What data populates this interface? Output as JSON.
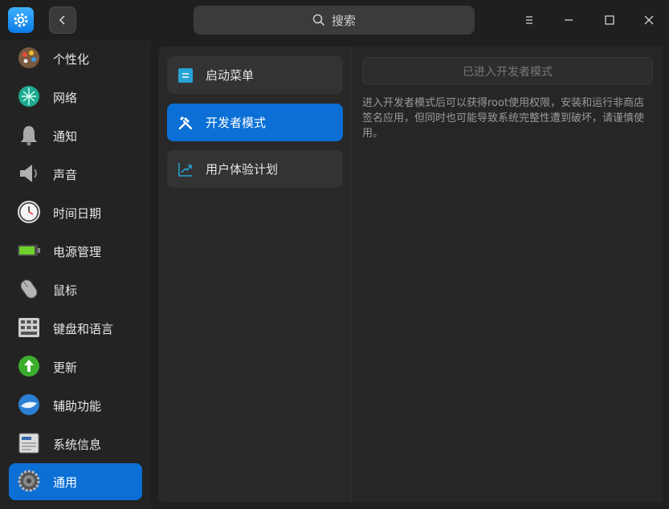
{
  "search": {
    "label": "搜索"
  },
  "sidebar": {
    "items": [
      {
        "label": "个性化",
        "icon": "personalization-icon"
      },
      {
        "label": "网络",
        "icon": "network-icon"
      },
      {
        "label": "通知",
        "icon": "bell-icon"
      },
      {
        "label": "声音",
        "icon": "speaker-icon"
      },
      {
        "label": "时间日期",
        "icon": "clock-icon"
      },
      {
        "label": "电源管理",
        "icon": "battery-icon"
      },
      {
        "label": "鼠标",
        "icon": "mouse-icon"
      },
      {
        "label": "键盘和语言",
        "icon": "keyboard-icon"
      },
      {
        "label": "更新",
        "icon": "update-icon"
      },
      {
        "label": "辅助功能",
        "icon": "accessibility-icon"
      },
      {
        "label": "系统信息",
        "icon": "system-info-icon"
      },
      {
        "label": "通用",
        "icon": "general-gear-icon"
      }
    ],
    "active_index": 11
  },
  "middle": {
    "items": [
      {
        "label": "启动菜单",
        "icon": "boot-menu-icon"
      },
      {
        "label": "开发者模式",
        "icon": "tools-icon"
      },
      {
        "label": "用户体验计划",
        "icon": "chart-trend-icon"
      }
    ],
    "active_index": 1
  },
  "right": {
    "dev_button_label": "已进入开发者模式",
    "description": "进入开发者模式后可以获得root使用权限，安装和运行非商店签名应用，但同时也可能导致系统完整性遭到破坏，请谨慎使用。"
  },
  "colors": {
    "accent": "#0b6fd6",
    "background": "#1f1f1f"
  }
}
